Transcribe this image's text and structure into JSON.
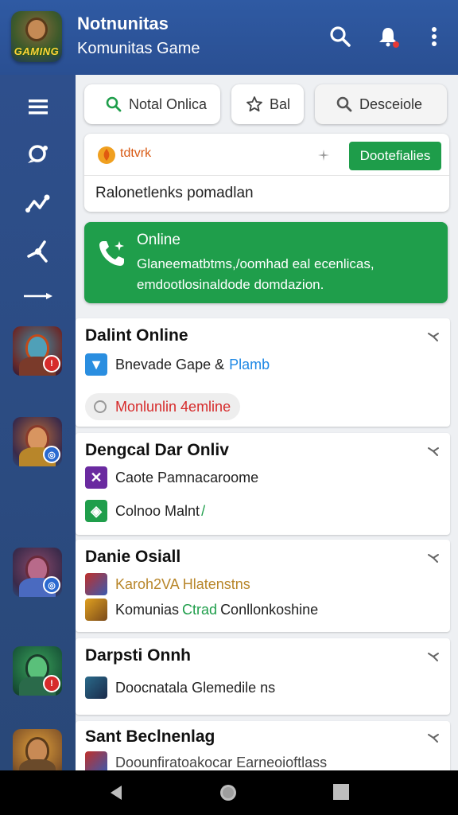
{
  "header": {
    "logo_text": "GAMING",
    "title": "Notnunitas",
    "subtitle": "Komunitas Game",
    "icons": [
      "search-icon",
      "notification-icon",
      "more-vert-icon"
    ],
    "notification_dot_color": "#e53935"
  },
  "rail": {
    "icons": [
      "menu-icon",
      "chat-icon",
      "route-icon",
      "share-icon",
      "arrow-icon"
    ]
  },
  "filters": [
    {
      "label": "Notal Onlica",
      "icon": "search-icon"
    },
    {
      "label": "Bal",
      "icon": "star-icon"
    },
    {
      "label": "Desceiole",
      "icon": "search-icon"
    }
  ],
  "promo": {
    "title": "tdtvrk",
    "button": "Dootefialies",
    "body": "Ralonetlenks pomadlan"
  },
  "online_card": {
    "title": "Online",
    "description_1": "Glaneematbtms,/oomhad eal ecenlicas,",
    "description_2": "emdootlosinaldode domdazion."
  },
  "list": [
    {
      "title": "Dalint Online",
      "row1_prefix": "Bnevade Gape &",
      "row1_link": "Plamb",
      "pill": "Monlunlin 4emline"
    },
    {
      "title": "Dengcal Dar Onliv",
      "row1": "Caote Pamnacaroome",
      "row2": "Colnoo Malnt",
      "row2_mark": "/"
    },
    {
      "title": "Danie Osiall",
      "row1": "Karoh2VA Hlatenstns",
      "row2_prefix": "Komunias",
      "row2_mid": "Ctrad",
      "row2_suffix": "Conllonkoshine"
    },
    {
      "title": "Darpsti Onnh",
      "row1": "Doocnatala Glemedile ns"
    },
    {
      "title": "Sant Beclnenlag",
      "row1": "Doounfiratoakocar Earneoioftlass"
    }
  ],
  "colors": {
    "accent_green": "#1f9e4b",
    "header_blue": "#2f5aa3",
    "link_blue": "#1e88e5",
    "alert_red": "#d62b2b"
  }
}
